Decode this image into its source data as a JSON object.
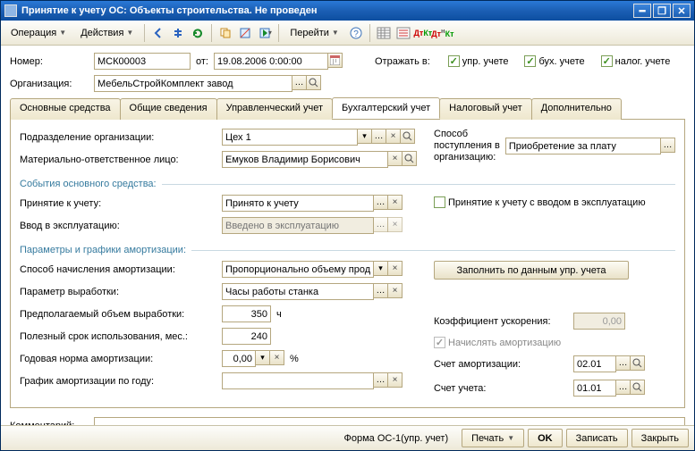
{
  "window": {
    "title": "Принятие к учету ОС: Объекты строительства. Не проведен"
  },
  "toolbar": {
    "operation": "Операция",
    "actions": "Действия",
    "goto": "Перейти"
  },
  "header": {
    "number_label": "Номер:",
    "number": "МСК00003",
    "from_label": "от:",
    "date": "19.08.2006 0:00:00",
    "reflect_label": "Отражать в:",
    "chk_upr": "упр. учете",
    "chk_buh": "бух. учете",
    "chk_nal": "налог. учете",
    "org_label": "Организация:",
    "org": "МебельСтройКомплект завод"
  },
  "tabs": {
    "t1": "Основные средства",
    "t2": "Общие сведения",
    "t3": "Управленческий учет",
    "t4": "Бухгалтерский учет",
    "t5": "Налоговый учет",
    "t6": "Дополнительно"
  },
  "form": {
    "podr_label": "Подразделение организации:",
    "podr": "Цех 1",
    "mol_label": "Материально-ответственное лицо:",
    "mol": "Емуков Владимир Борисович",
    "post_label_l1": "Способ",
    "post_label_l2": "поступления в",
    "post_label_l3": "организацию:",
    "post": "Приобретение за плату",
    "section_events": "События основного средства:",
    "prin_label": "Принятие к учету:",
    "prin": "Принято к учету",
    "chk_commission": "Принятие к учету с вводом в эксплуатацию",
    "vvod_label": "Ввод в эксплуатацию:",
    "vvod_placeholder": "Введено в эксплуатацию",
    "section_params": "Параметры и графики амортизации:",
    "sposob_label": "Способ начисления амортизации:",
    "sposob": "Пропорционально объему продукции (работ",
    "fill_btn": "Заполнить по данным упр. учета",
    "param_label": "Параметр выработки:",
    "param": "Часы работы станка",
    "volume_label": "Предполагаемый объем выработки:",
    "volume": "350",
    "volume_unit": "ч",
    "koef_label": "Коэффициент ускорения:",
    "koef": "0,00",
    "srok_label": "Полезный срок использования, мес.:",
    "srok": "240",
    "chk_amort": "Начислять амортизацию",
    "norma_label": "Годовая норма амортизации:",
    "norma": "0,00",
    "norma_unit": "%",
    "schet_amort_label": "Счет амортизации:",
    "schet_amort": "02.01",
    "grafik_label": "График амортизации по году:",
    "grafik": "",
    "schet_ucheta_label": "Счет учета:",
    "schet_ucheta": "01.01"
  },
  "footer": {
    "comment_label": "Комментарий:",
    "forma": "Форма ОС-1(упр. учет)",
    "print": "Печать",
    "ok": "OK",
    "save": "Записать",
    "close": "Закрыть"
  }
}
